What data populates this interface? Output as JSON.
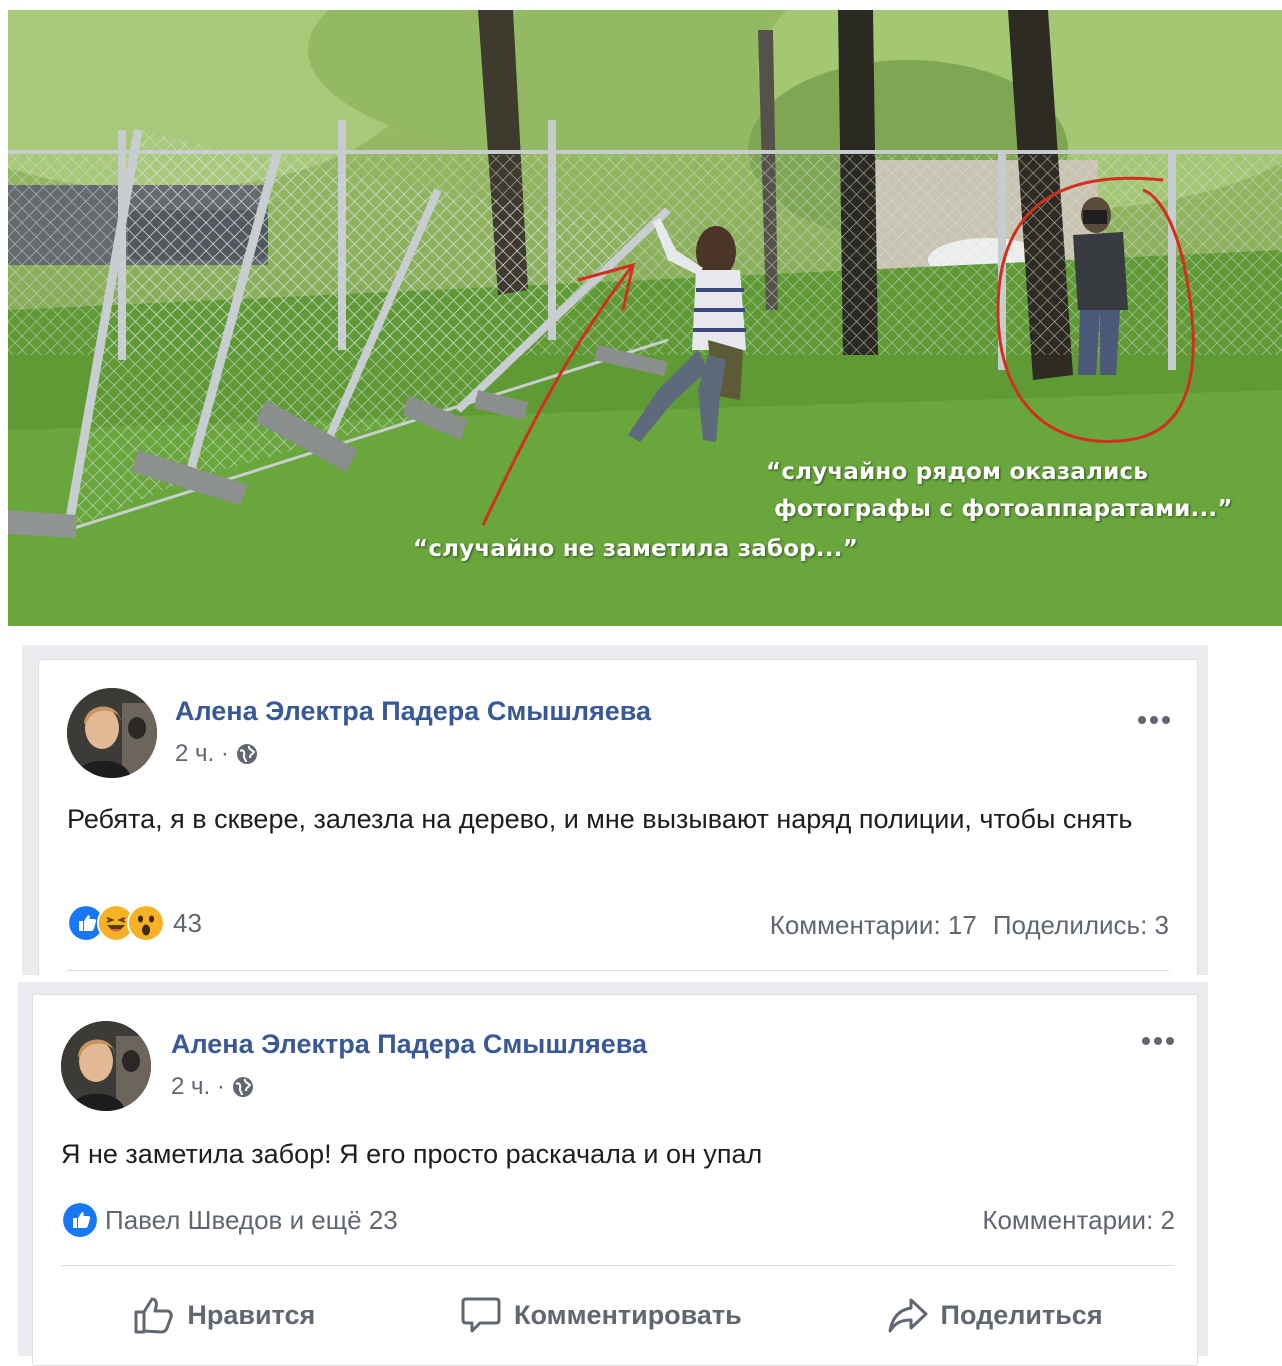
{
  "photo": {
    "caption_photographers_line1": "“случайно рядом оказались",
    "caption_photographers_line2": "фотографы с фотоаппаратами...”",
    "caption_fence": "“случайно не заметила забор...”"
  },
  "posts": [
    {
      "author": "Алена Электра Падера Смышляева",
      "time": "2 ч. ·",
      "text": "Ребята, я в сквере, залезла на дерево, и мне вызывают наряд полиции, чтобы снять",
      "reaction_count": "43",
      "comments": "Комментарии: 17",
      "shares": "Поделились: 3"
    },
    {
      "author": "Алена Электра Падера Смышляева",
      "time": "2 ч. ·",
      "text": "Я не заметила забор! Я его просто раскачала и он упал",
      "likes_text": "Павел Шведов и ещё 23",
      "comments": "Комментарии: 2",
      "actions": {
        "like": "Нравится",
        "comment": "Комментировать",
        "share": "Поделиться"
      }
    }
  ],
  "colors": {
    "author": "#385898",
    "meta": "#606770",
    "like_blue": "#1877f2",
    "annotation_red": "#d32f1f"
  },
  "icons": [
    "globe-icon",
    "more-icon",
    "like-reaction-icon",
    "haha-reaction-icon",
    "wow-reaction-icon",
    "thumbs-up-icon",
    "comment-icon",
    "share-icon"
  ]
}
